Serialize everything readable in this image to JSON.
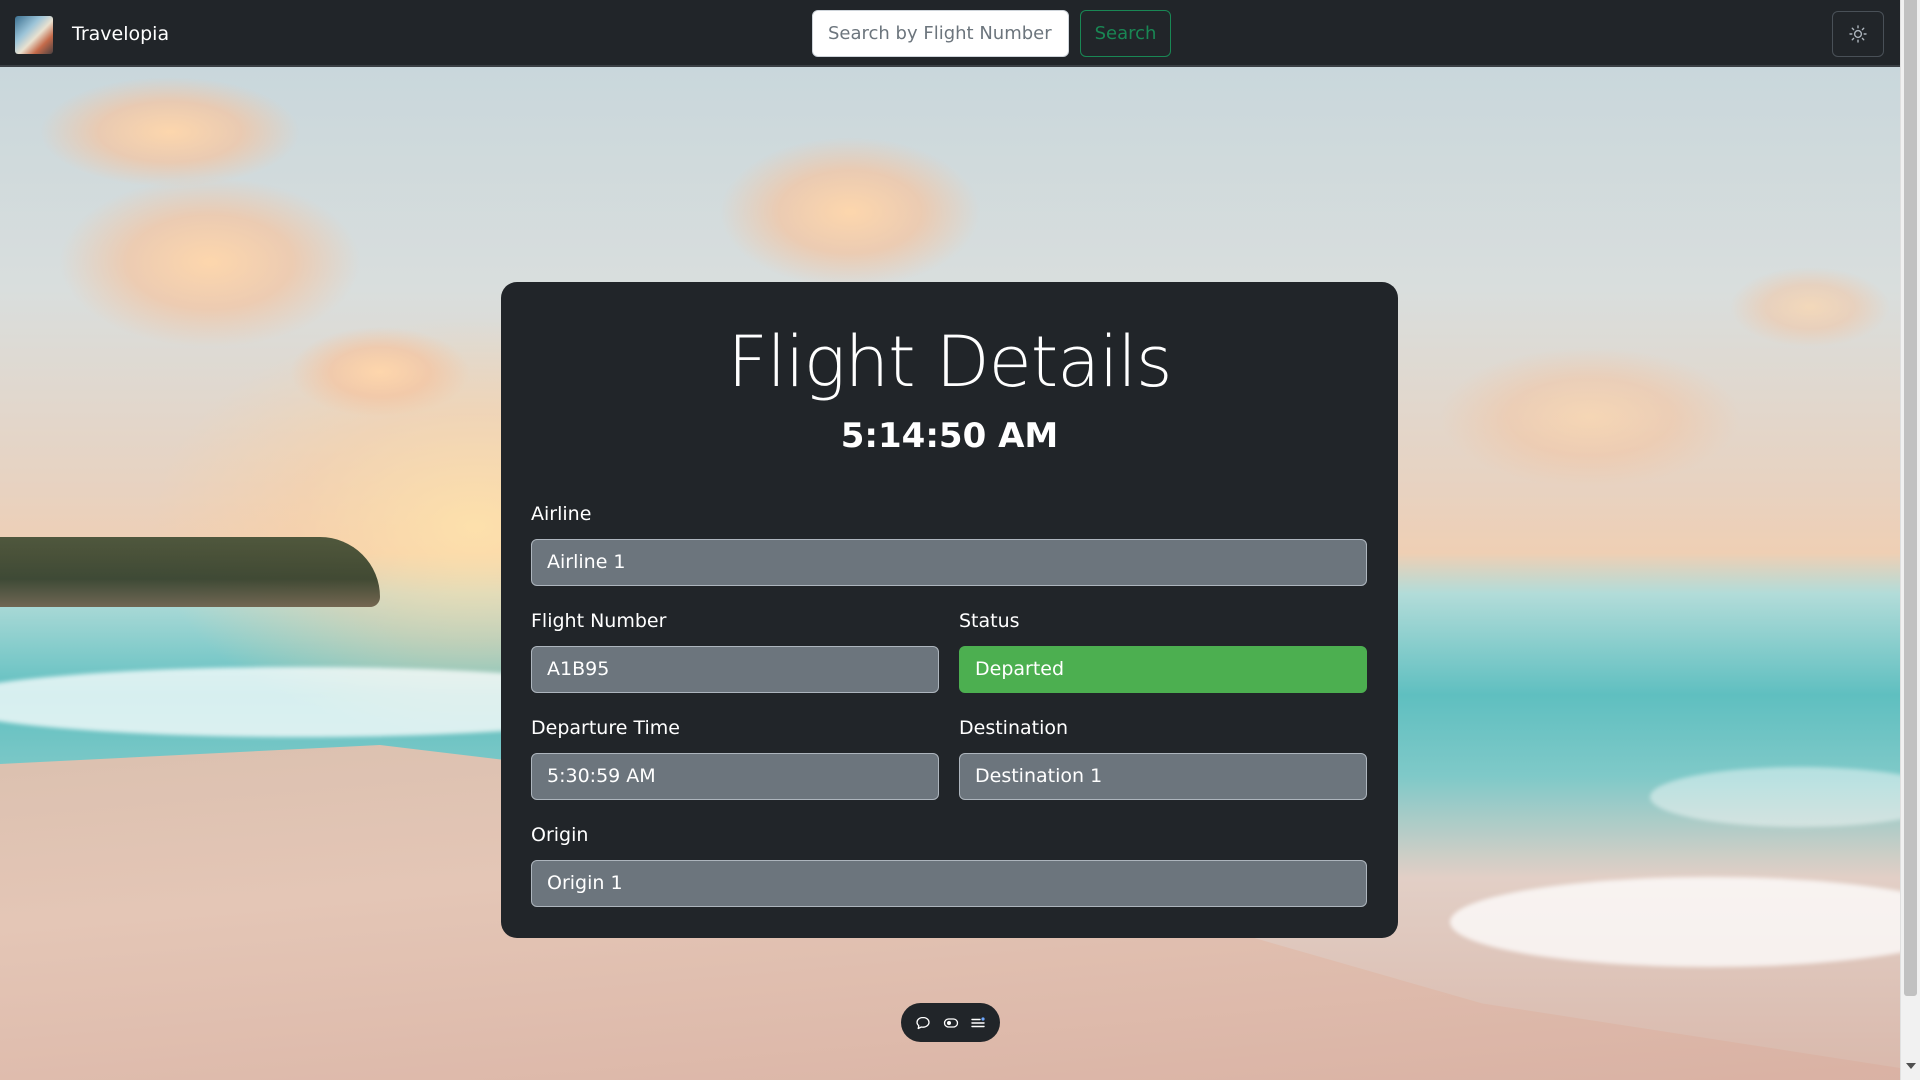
{
  "navbar": {
    "brand_name": "Travelopia",
    "search": {
      "placeholder": "Search by Flight Number",
      "value": ""
    },
    "search_label": "Search",
    "theme_icon": "sun-icon"
  },
  "card": {
    "title": "Flight Details",
    "clock": "5:14:50 AM",
    "fields": {
      "airline": {
        "label": "Airline",
        "value": "Airline 1"
      },
      "flight_number": {
        "label": "Flight Number",
        "value": "A1B95"
      },
      "status": {
        "label": "Status",
        "value": "Departed",
        "color": "#4caf50"
      },
      "departure_time": {
        "label": "Departure Time",
        "value": "5:30:59 AM"
      },
      "destination": {
        "label": "Destination",
        "value": "Destination 1"
      },
      "origin": {
        "label": "Origin",
        "value": "Origin 1"
      }
    }
  },
  "toolbar": {
    "icons": [
      "chat-bubble-icon",
      "eye-toggle-icon",
      "list-icon"
    ]
  },
  "colors": {
    "navbar_bg": "#212529",
    "card_bg": "#212529",
    "field_bg": "#6c757d",
    "search_accent": "#198754"
  }
}
